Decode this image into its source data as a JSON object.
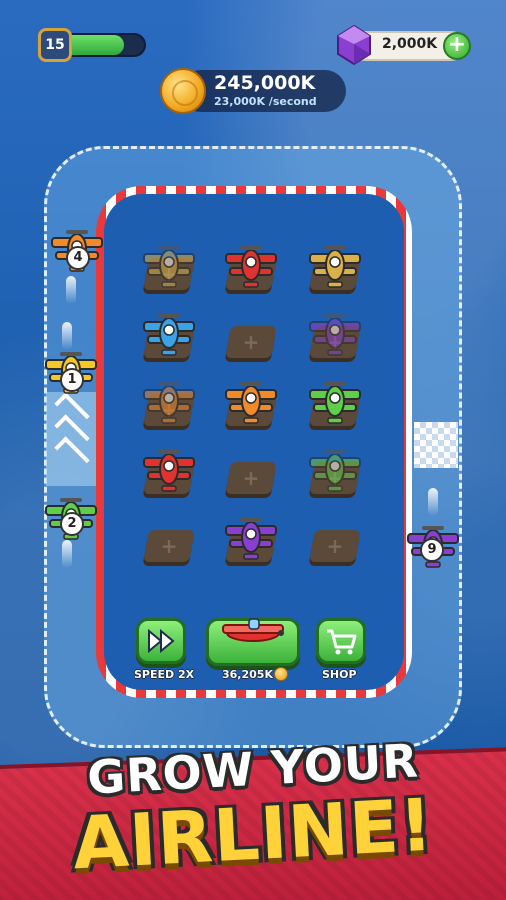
{
  "hud": {
    "level": "15",
    "level_progress": 0.75,
    "gems": "2,000K",
    "gem_add": "+",
    "coins": "245,000K",
    "coin_rate": "23,000K /second"
  },
  "track_planes": [
    {
      "level": "4",
      "color": "#f08a2a"
    },
    {
      "level": "1",
      "color": "#f5c82a"
    },
    {
      "level": "2",
      "color": "#5fcf4a"
    },
    {
      "level": "9",
      "color": "#8a3fd0"
    }
  ],
  "grid": [
    {
      "state": "ghost",
      "color": "#d9b04a"
    },
    {
      "state": "plane",
      "color": "#e0332f"
    },
    {
      "state": "plane",
      "color": "#d9b04a"
    },
    {
      "state": "plane",
      "color": "#3aa3e8"
    },
    {
      "state": "empty",
      "color": ""
    },
    {
      "state": "ghost",
      "color": "#8a3fd0"
    },
    {
      "state": "ghost",
      "color": "#f08a2a"
    },
    {
      "state": "plane",
      "color": "#f08a2a"
    },
    {
      "state": "plane",
      "color": "#5fcf4a"
    },
    {
      "state": "plane",
      "color": "#e0332f"
    },
    {
      "state": "empty",
      "color": ""
    },
    {
      "state": "ghost",
      "color": "#5fcf4a"
    },
    {
      "state": "empty",
      "color": ""
    },
    {
      "state": "plane",
      "color": "#8a3fd0"
    },
    {
      "state": "empty",
      "color": ""
    }
  ],
  "buttons": {
    "speed_label": "SPEED 2X",
    "buy_price": "36,205K",
    "shop_label": "SHOP"
  },
  "banner": {
    "line1": "GROW YOUR",
    "line2": "AIRLINE!"
  }
}
